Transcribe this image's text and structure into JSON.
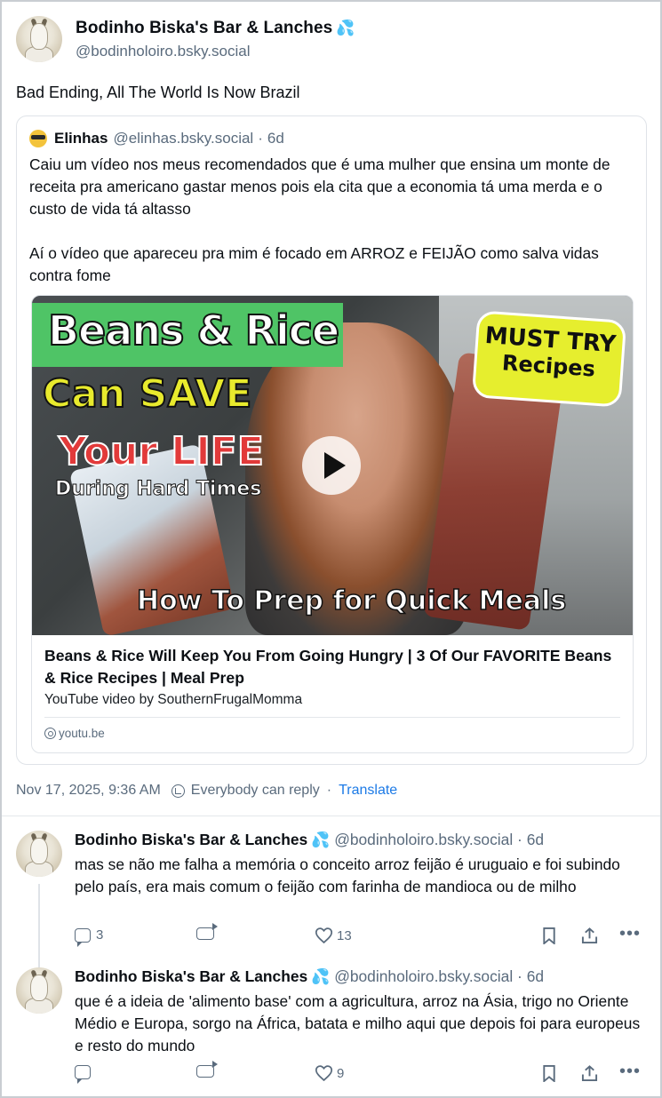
{
  "post": {
    "author_name": "Bodinho Biska's Bar & Lanches",
    "author_emoji": "💦",
    "author_handle": "@bodinholoiro.bsky.social",
    "text": "Bad Ending, All The World Is Now Brazil",
    "timestamp": "Nov 17, 2025, 9:36 AM",
    "reply_setting": "Everybody can reply",
    "separator": "·",
    "translate_label": "Translate"
  },
  "quote": {
    "author_name": "Elinhas",
    "author_handle": "@elinhas.bsky.social",
    "separator": "·",
    "time": "6d",
    "paragraph1": "Caiu um vídeo nos meus recomendados que é uma mulher que ensina um monte de receita pra americano gastar menos pois ela cita que a economia tá uma merda e o custo de vida tá altasso",
    "paragraph2": "Aí o vídeo que apareceu pra mim é focado em ARROZ e FEIJÃO como salva vidas contra fome"
  },
  "embed": {
    "thumbnail": {
      "title": "Beans & Rice",
      "line2": "Can SAVE",
      "line3": "Your LIFE",
      "line4": "During Hard Times",
      "badge_line1": "MUST TRY",
      "badge_line2": "Recipes",
      "bottom": "How To Prep for Quick Meals"
    },
    "title": "Beans & Rice Will Keep You From Going Hungry | 3 Of Our FAVORITE Beans & Rice Recipes | Meal Prep",
    "subtitle": "YouTube video by SouthernFrugalMomma",
    "domain": "youtu.be"
  },
  "replies": [
    {
      "author_name": "Bodinho Biska's Bar & Lanches",
      "author_emoji": "💦",
      "author_handle": "@bodinholoiro.bsky.social",
      "separator": "·",
      "time": "6d",
      "text": "mas se não me falha a memória o conceito arroz feijão é uruguaio e foi subindo pelo país, era mais comum o feijão com farinha de mandioca ou de milho",
      "comments": "3",
      "likes": "13"
    },
    {
      "author_name": "Bodinho Biska's Bar & Lanches",
      "author_emoji": "💦",
      "author_handle": "@bodinholoiro.bsky.social",
      "separator": "·",
      "time": "6d",
      "text": "que é a ideia de 'alimento base' com a agricultura, arroz na Ásia, trigo no Oriente Médio e Europa, sorgo na África, batata e milho aqui que depois foi para europeus e resto do mundo",
      "likes": "9"
    }
  ],
  "icons": {
    "comment": "comment-icon",
    "repost": "repost-icon",
    "like": "heart-icon",
    "bookmark": "bookmark-icon",
    "share": "share-icon",
    "more": "more-icon",
    "more_glyph": "•••",
    "play": "play-icon",
    "globe": "globe-icon"
  },
  "colors": {
    "accent": "#1c7ae6",
    "muted": "#5a6b7d",
    "border": "#dfe3e8"
  }
}
